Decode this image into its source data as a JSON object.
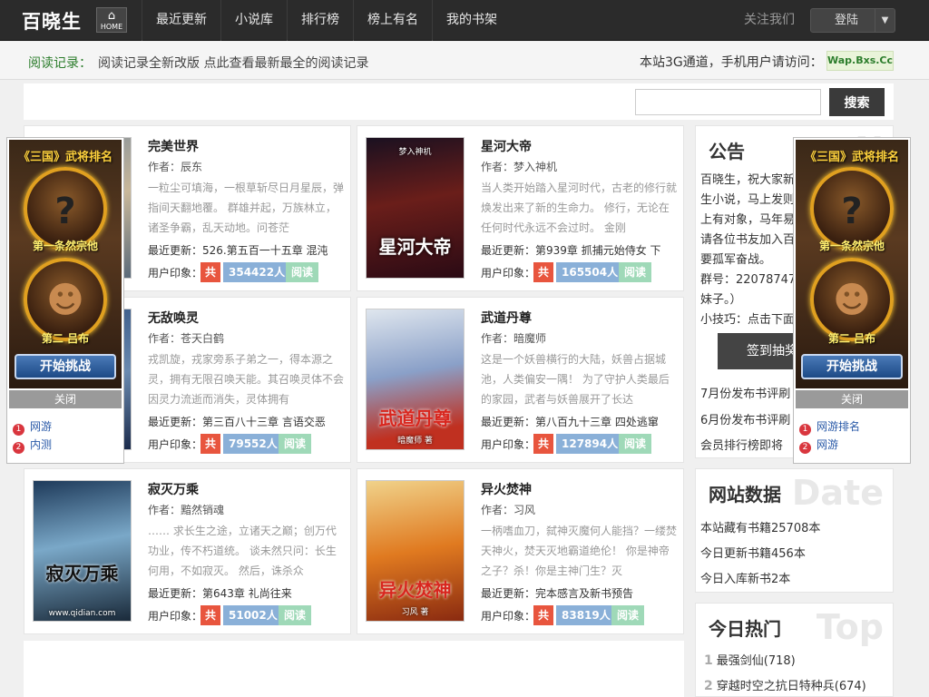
{
  "header": {
    "logo": "百晓生",
    "home_label": "HOME",
    "nav": [
      "最近更新",
      "小说库",
      "排行榜",
      "榜上有名",
      "我的书架"
    ],
    "follow": "关注我们",
    "login": "登陆"
  },
  "info": {
    "reading_label": "阅读记录：",
    "reading_text": "阅读记录全新改版 点此查看最新最全的阅读记录",
    "mobile_text": "本站3G通道，手机用户请访问：",
    "wap": "Wap.Bxs.Cc"
  },
  "search": {
    "placeholder": "",
    "button": "搜索"
  },
  "book_labels": {
    "author_prefix": "作者：",
    "update_prefix": "最近更新：",
    "impression": "用户印象：",
    "gong": "共",
    "read": "阅读"
  },
  "books": [
    {
      "title": "完美世界",
      "author": "辰东",
      "desc": "一粒尘可填海，一根草斩尽日月星辰，弹指间天翻地覆。 群雄并起，万族林立，诸圣争霸，乱天动地。问苍茫",
      "update": "526.第五百一十五章 混沌",
      "count": "354422人"
    },
    {
      "title": "星河大帝",
      "author": "梦入神机",
      "desc": "当人类开始踏入星河时代，古老的修行就焕发出来了新的生命力。 修行，无论在任何时代永远不会过时。 金刚",
      "update": "第939章 抓捕元始侍女 下",
      "count": "165504人",
      "cover_text": "星河大帝",
      "cover_sub": "梦入神机"
    },
    {
      "title": "无敌唤灵",
      "author": "苍天白鹤",
      "desc": "戎凯旋，戎家旁系子弟之一，得本源之灵，拥有无限召唤天能。其召唤灵体不会因灵力流逝而消失，灵体拥有",
      "update": "第三百八十三章 言语交恶",
      "count": "79552人"
    },
    {
      "title": "武道丹尊",
      "author": "暗魔师",
      "desc": "这是一个妖兽横行的大陆，妖兽占据城池，人类偏安一隅！ 为了守护人类最后的家园，武者与妖兽展开了长达",
      "update": "第八百九十三章 四处逃窜",
      "count": "127894人",
      "cover_text": "武道丹尊",
      "cover_sub": "暗魔师 著"
    },
    {
      "title": "寂灭万乘",
      "author": "黯然销魂",
      "desc": "…… 求长生之途，立诸天之巅；创万代功业，传不朽道统。 谈未然只问：长生何用，不如寂灭。 然后，诛杀众",
      "update": "第643章 礼尚往来",
      "count": "51002人",
      "cover_text": "寂灭万乘",
      "cover_sub": "www.qidian.com"
    },
    {
      "title": "异火焚神",
      "author": "习风",
      "desc": "一柄嗜血刀，弑神灭魔何人能挡？一缕焚天神火，焚天灭地霸道绝伦！ 你是神帝之子？杀！你是主神门生？灭",
      "update": "完本感言及新书预告",
      "count": "83819人",
      "cover_text": "异火焚神",
      "cover_sub": "习风 著"
    }
  ],
  "announce": {
    "title": "公告",
    "watermark": "N",
    "lines": [
      "百晓生，祝大家新",
      "生小说，马上发则",
      "上有对象，马年易",
      "请各位书友加入百",
      "要孤军奋战。",
      "群号：22078747",
      "妹子。）",
      "小技巧：点击下面",
      "以获得大量积分I"
    ],
    "sign_button": "签到抽奖",
    "news": [
      "7月份发布书评刷",
      "6月份发布书评刷",
      "会员排行榜即将"
    ]
  },
  "site_data": {
    "title": "网站数据",
    "watermark": "Date",
    "lines": [
      "本站藏有书籍25708本",
      "今日更新书籍456本",
      "今日入库新书2本"
    ]
  },
  "hot": {
    "title": "今日热门",
    "watermark": "Top",
    "items": [
      {
        "num": "1",
        "text": "最强剑仙(718)"
      },
      {
        "num": "2",
        "text": "穿越时空之抗日特种兵(674)"
      }
    ]
  },
  "ad_left": {
    "title": "《三国》武将排名",
    "cap1": "第一条然宗他",
    "cap2": "第二 吕布",
    "button": "开始挑战",
    "close": "关闭",
    "links": [
      {
        "num": "1",
        "text": "网游"
      },
      {
        "num": "2",
        "text": "内测"
      }
    ]
  },
  "ad_right": {
    "title": "《三国》武将排名",
    "cap1": "第一条然宗他",
    "cap2": "第二 吕布",
    "button": "开始挑战",
    "close": "关闭",
    "links": [
      {
        "num": "1",
        "text": "网游排名"
      },
      {
        "num": "2",
        "text": "网游"
      }
    ]
  },
  "colors": {
    "topbar": "#2b2b2b",
    "gong": "#e8553e",
    "count": "#8ab0d8",
    "read": "#9fd9b8",
    "reading_label": "#2c7d2c"
  }
}
